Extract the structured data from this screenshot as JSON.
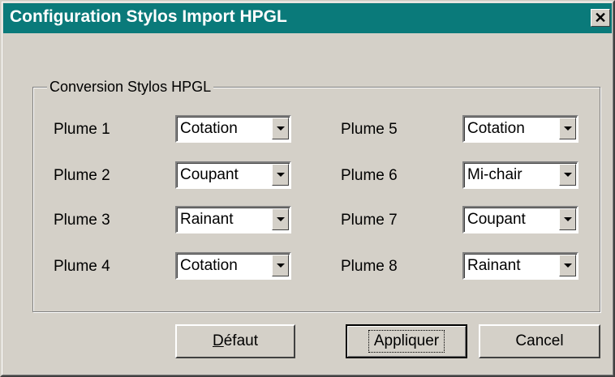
{
  "window": {
    "title": "Configuration Stylos Import HPGL",
    "close_glyph": "✕"
  },
  "group": {
    "legend": "Conversion Stylos HPGL"
  },
  "pens": [
    {
      "label": "Plume 1",
      "value": "Cotation"
    },
    {
      "label": "Plume 2",
      "value": "Coupant"
    },
    {
      "label": "Plume 3",
      "value": "Rainant"
    },
    {
      "label": "Plume 4",
      "value": "Cotation"
    },
    {
      "label": "Plume 5",
      "value": "Cotation"
    },
    {
      "label": "Plume 6",
      "value": "Mi-chair"
    },
    {
      "label": "Plume 7",
      "value": "Coupant"
    },
    {
      "label": "Plume 8",
      "value": "Rainant"
    }
  ],
  "buttons": {
    "default_first": "D",
    "default_rest": "éfaut",
    "apply": "Appliquer",
    "cancel": "Cancel"
  },
  "colors": {
    "titlebar": "#0a7a7a",
    "face": "#d4d0c8"
  }
}
